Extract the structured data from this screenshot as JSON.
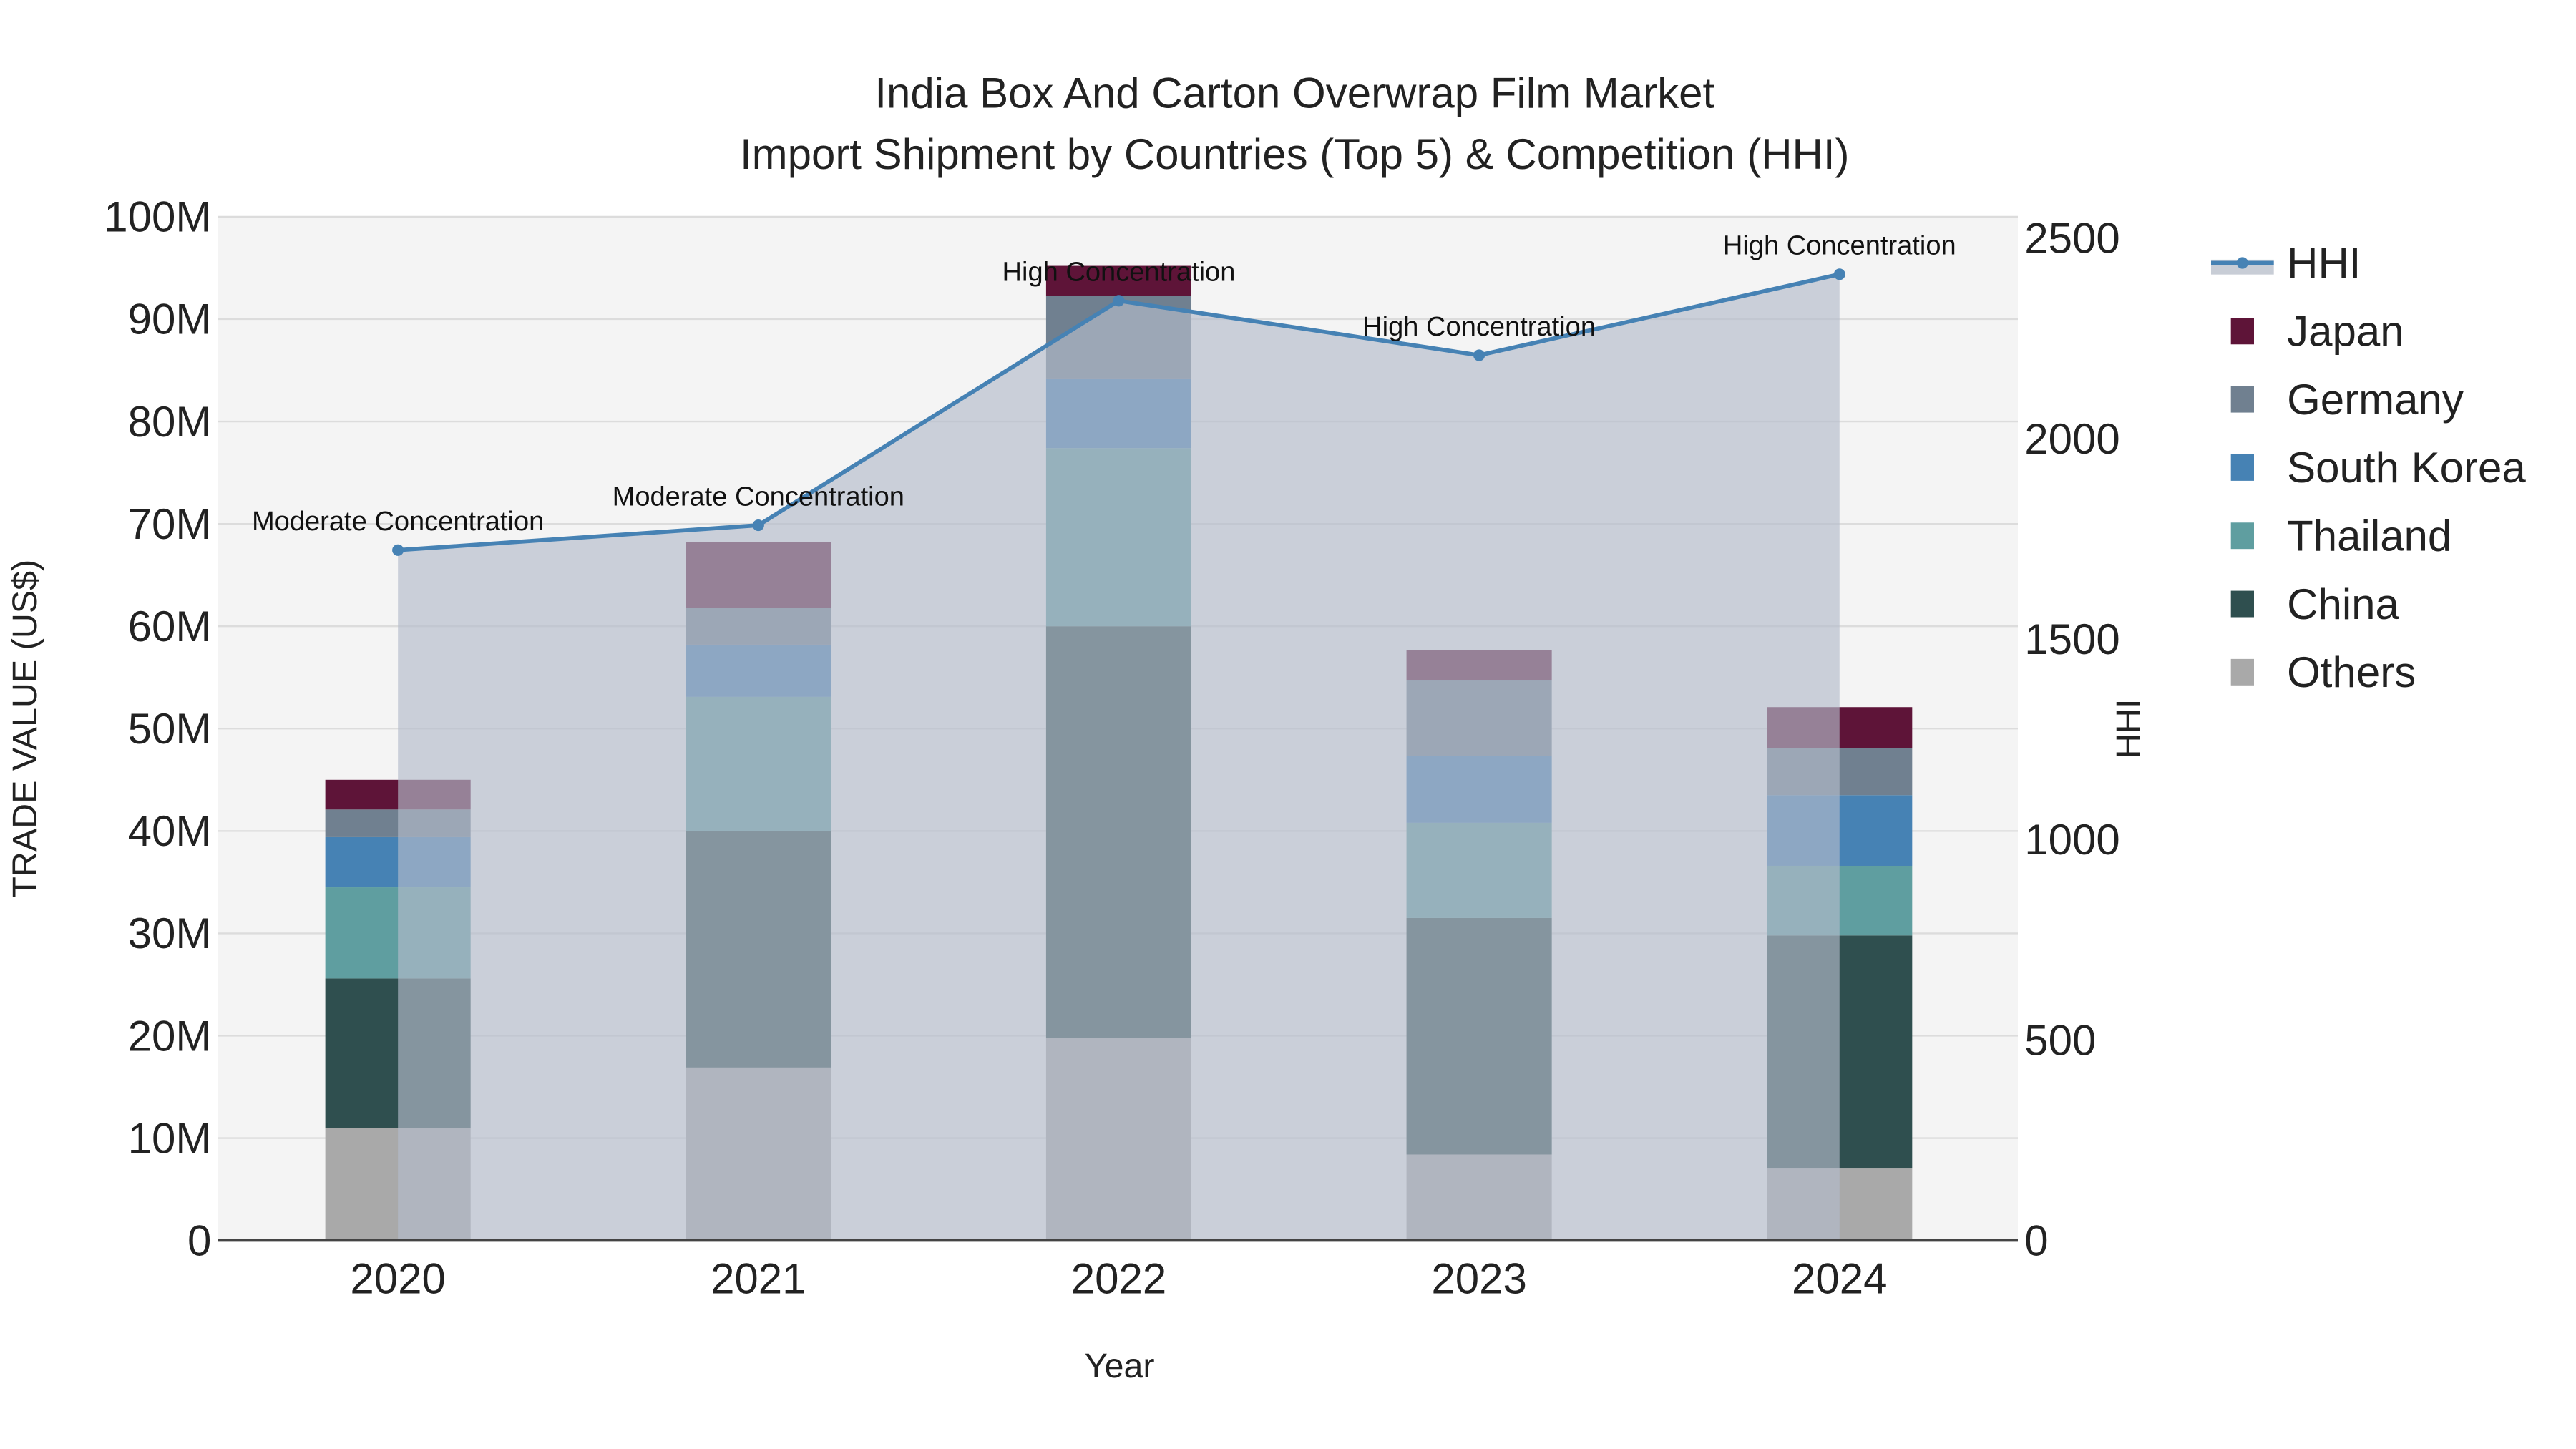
{
  "chart_data": {
    "type": "bar",
    "title_line1": "India Box And Carton Overwrap Film Market",
    "title_line2": "Import Shipment by Countries (Top 5) & Competition (HHI)",
    "xlabel": "Year",
    "ylabel": "TRADE VALUE (US$)",
    "y2label": "HHI",
    "categories": [
      "2020",
      "2021",
      "2022",
      "2023",
      "2024"
    ],
    "ylim": [
      0,
      100000000
    ],
    "y_ticks": [
      0,
      10000000,
      20000000,
      30000000,
      40000000,
      50000000,
      60000000,
      70000000,
      80000000,
      90000000,
      100000000
    ],
    "y_tick_labels": [
      "0",
      "10M",
      "20M",
      "30M",
      "40M",
      "50M",
      "60M",
      "70M",
      "80M",
      "90M",
      "100M"
    ],
    "y2lim": [
      0,
      2550
    ],
    "y2_ticks": [
      0,
      500,
      1000,
      1500,
      2000,
      2500
    ],
    "y2_tick_labels": [
      "0",
      "500",
      "1000",
      "1500",
      "2000",
      "2500"
    ],
    "series": [
      {
        "name": "Others",
        "color": "#a9a9a9",
        "values": [
          11000000,
          16900000,
          19800000,
          8400000,
          7100000
        ]
      },
      {
        "name": "China",
        "color": "#2f4f4f",
        "values": [
          14600000,
          23100000,
          40200000,
          23100000,
          22700000
        ]
      },
      {
        "name": "Thailand",
        "color": "#5f9ea0",
        "values": [
          8900000,
          13100000,
          17400000,
          9300000,
          6800000
        ]
      },
      {
        "name": "South Korea",
        "color": "#4682b4",
        "values": [
          4900000,
          5100000,
          6800000,
          6500000,
          6900000
        ]
      },
      {
        "name": "Germany",
        "color": "#708090",
        "values": [
          2700000,
          3600000,
          8100000,
          7400000,
          4600000
        ]
      },
      {
        "name": "Japan",
        "color": "#5e1438",
        "values": [
          2900000,
          6400000,
          2900000,
          3000000,
          4000000
        ]
      }
    ],
    "hhi": {
      "name": "HHI",
      "color": "#4682b4",
      "values": [
        1722,
        1784,
        2344,
        2208,
        2410
      ],
      "labels": [
        "Moderate Concentration",
        "Moderate Concentration",
        "High Concentration",
        "High Concentration",
        "High Concentration"
      ]
    },
    "legend": [
      "HHI",
      "Japan",
      "Germany",
      "South Korea",
      "Thailand",
      "China",
      "Others"
    ],
    "legend_placement": "right",
    "grid": true
  }
}
